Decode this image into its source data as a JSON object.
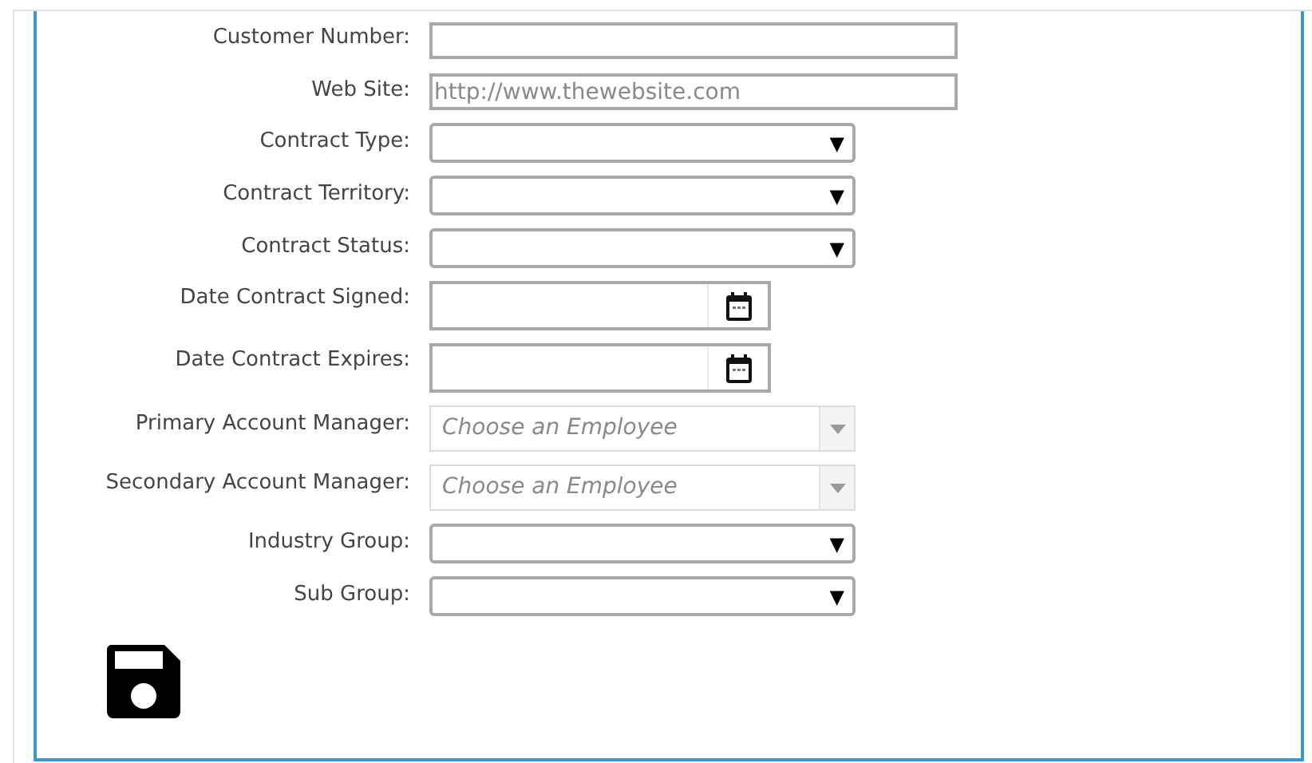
{
  "fields": [
    {
      "label": "Customer Number:",
      "kind": "text"
    },
    {
      "label": "Web Site:",
      "kind": "text",
      "placeholder": "http://www.thewebsite.com"
    },
    {
      "label": "Contract Type:",
      "kind": "select",
      "arrow": "▼"
    },
    {
      "label": "Contract Territory:",
      "kind": "select",
      "arrow": "▼"
    },
    {
      "label": "Contract Status:",
      "kind": "select",
      "arrow": "▼"
    },
    {
      "label": "Date Contract Signed:",
      "kind": "date"
    },
    {
      "label": "Date Contract Expires:",
      "kind": "date"
    },
    {
      "label": "Primary Account Manager:",
      "kind": "chosen",
      "placeholder": "Choose an Employee"
    },
    {
      "label": "Secondary Account Manager:",
      "kind": "chosen",
      "placeholder": "Choose an Employee"
    },
    {
      "label": "Industry Group:",
      "kind": "select",
      "arrow": "▼"
    },
    {
      "label": "Sub Group:",
      "kind": "select",
      "arrow": "▼"
    }
  ]
}
